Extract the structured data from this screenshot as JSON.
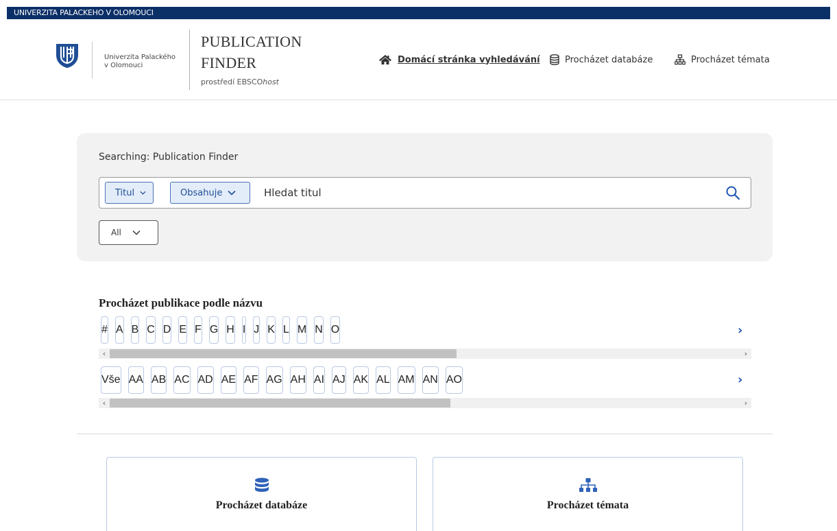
{
  "topbar": {
    "title": "UNIVERZITA PALACKEHO V OLOMOUCI"
  },
  "brand": {
    "university_line1": "Univerzita Palackého",
    "university_line2": "v Olomouci",
    "app_title_line1": "PUBLICATION",
    "app_title_line2": "FINDER",
    "subtitle_prefix": "prostředí EBSCO",
    "subtitle_host": "host"
  },
  "nav": {
    "home": {
      "label": "Domácí stránka vyhledávání",
      "icon": "home-icon",
      "active": true
    },
    "databases": {
      "label": "Procházet databáze",
      "icon": "database-icon"
    },
    "subjects": {
      "label": "Procházet témata",
      "icon": "sitemap-icon"
    }
  },
  "search": {
    "label": "Searching: Publication Finder",
    "field_select": "Titul",
    "match_select": "Obsahuje",
    "placeholder": "Hledat titul",
    "value": "",
    "scope_select": "All"
  },
  "browse": {
    "heading": "Procházet publikace podle názvu",
    "letters": [
      "#",
      "A",
      "B",
      "C",
      "D",
      "E",
      "F",
      "G",
      "H",
      "I",
      "J",
      "K",
      "L",
      "M",
      "N",
      "O"
    ],
    "subletters": [
      "Vše",
      "AA",
      "AB",
      "AC",
      "AD",
      "AE",
      "AF",
      "AG",
      "AH",
      "AI",
      "AJ",
      "AK",
      "AL",
      "AM",
      "AN",
      "AO"
    ],
    "row1_scroll": 0.55,
    "row2_scroll": 0.54
  },
  "cards": [
    {
      "label": "Procházet databáze",
      "icon": "database-icon"
    },
    {
      "label": "Procházet témata",
      "icon": "sitemap-icon"
    }
  ],
  "colors": {
    "topbar": "#0b2f67",
    "accent": "#1f55b3",
    "select_bg": "#e3ecf9",
    "panel_bg": "#f2f2f2"
  }
}
